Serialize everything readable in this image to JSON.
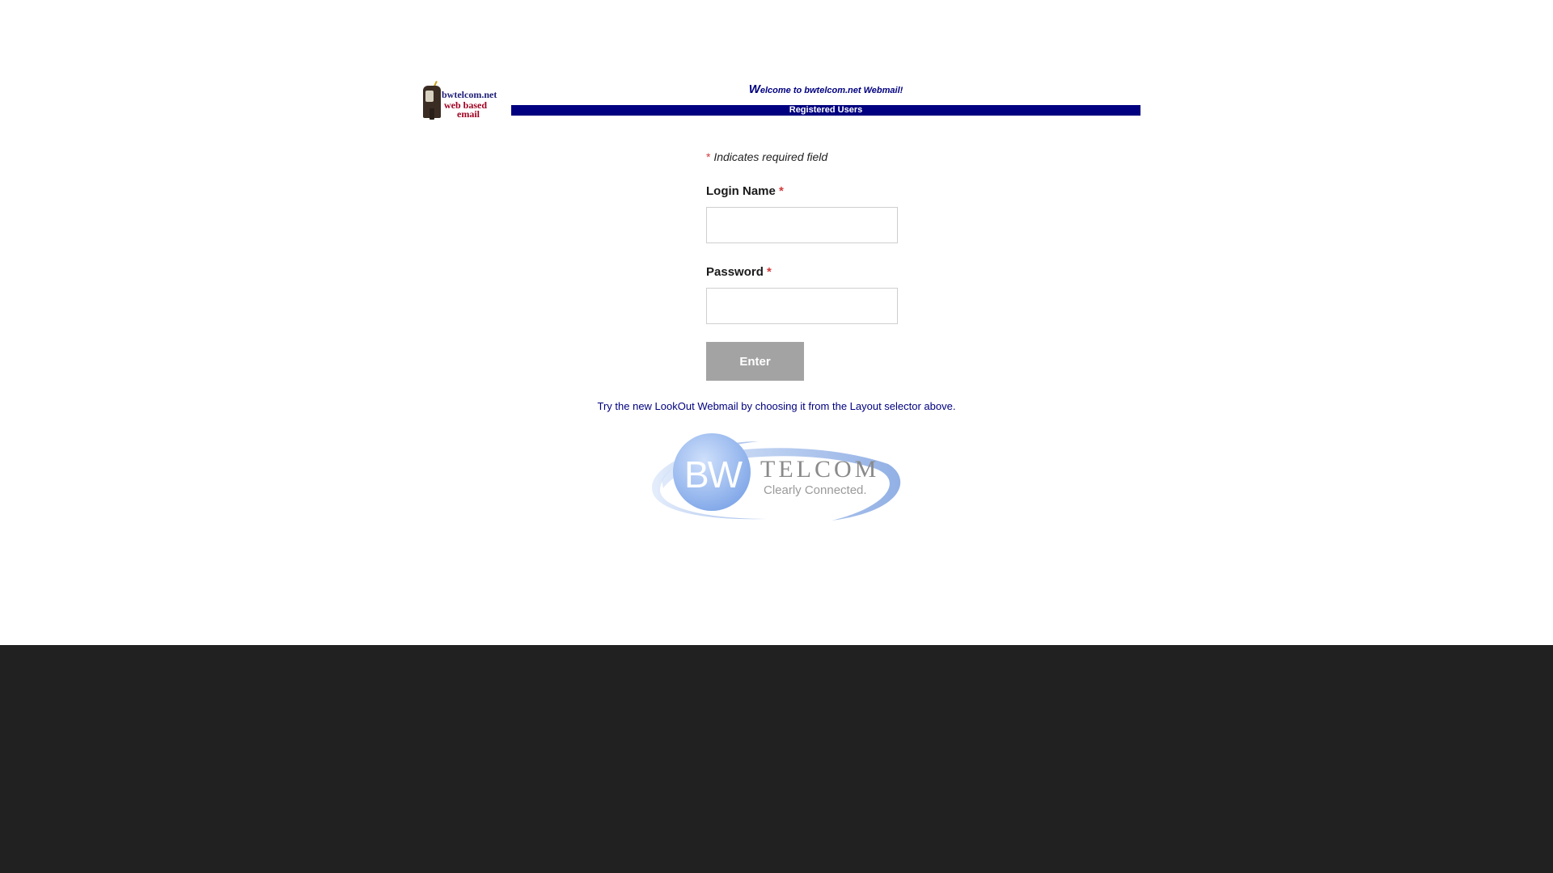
{
  "header": {
    "logo_line1": "bwtelcom.net",
    "logo_line2": "web based",
    "logo_line3": "email",
    "welcome_first": "W",
    "welcome_rest": "elcome to bwtelcom.net Webmail!",
    "registered_users": "Registered Users"
  },
  "form": {
    "required_star": "*",
    "required_note": "Indicates required field",
    "login_label": "Login Name",
    "login_value": "",
    "password_label": "Password",
    "password_value": "",
    "enter_label": "Enter"
  },
  "message": "Try the new LookOut Webmail by choosing it from the Layout selector above.",
  "company_logo": {
    "mark": "BW",
    "name": "TELCOM",
    "tagline": "Clearly Connected."
  },
  "colors": {
    "header_bar": "#000080",
    "required_star": "#d23b3b",
    "button": "#a3a3a3",
    "footer_band": "#212121"
  }
}
